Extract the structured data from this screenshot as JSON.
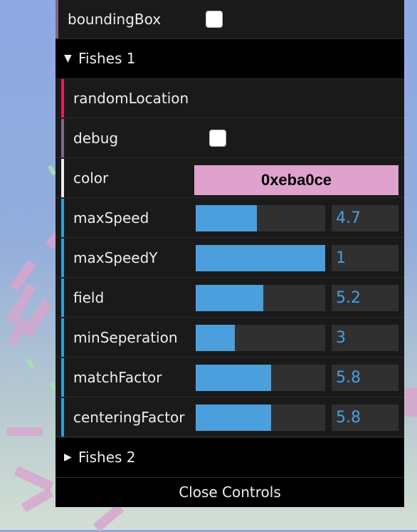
{
  "colors": {
    "panel_bg": "#1a1a1a",
    "folder_bg": "#000000",
    "slider_fill": "#4b9fdc",
    "number_text": "#4b9fdc",
    "color_value": "#eba0ce",
    "stripe_boolean": "#806787",
    "stripe_function": "#e61d5f",
    "stripe_number": "#2fa1d6",
    "stripe_color": "#eeeeee"
  },
  "top_row": {
    "label": "boundingBox",
    "checked": false
  },
  "folders": [
    {
      "title": "Fishes 1",
      "open": true,
      "arrow_icon": "triangle-down-icon",
      "controllers": [
        {
          "type": "function",
          "label": "randomLocation"
        },
        {
          "type": "boolean",
          "label": "debug",
          "checked": false
        },
        {
          "type": "color",
          "label": "color",
          "value": "0xeba0ce"
        },
        {
          "type": "number",
          "label": "maxSpeed",
          "value": "4.7",
          "fill": 0.47
        },
        {
          "type": "number",
          "label": "maxSpeedY",
          "value": "1",
          "fill": 1.0
        },
        {
          "type": "number",
          "label": "field",
          "value": "5.2",
          "fill": 0.52
        },
        {
          "type": "number",
          "label": "minSeperation",
          "value": "3",
          "fill": 0.3
        },
        {
          "type": "number",
          "label": "matchFactor",
          "value": "5.8",
          "fill": 0.58
        },
        {
          "type": "number",
          "label": "centeringFactor",
          "value": "5.8",
          "fill": 0.58
        }
      ]
    },
    {
      "title": "Fishes 2",
      "open": false,
      "arrow_icon": "triangle-right-icon",
      "controllers": []
    }
  ],
  "close_button": "Close Controls"
}
